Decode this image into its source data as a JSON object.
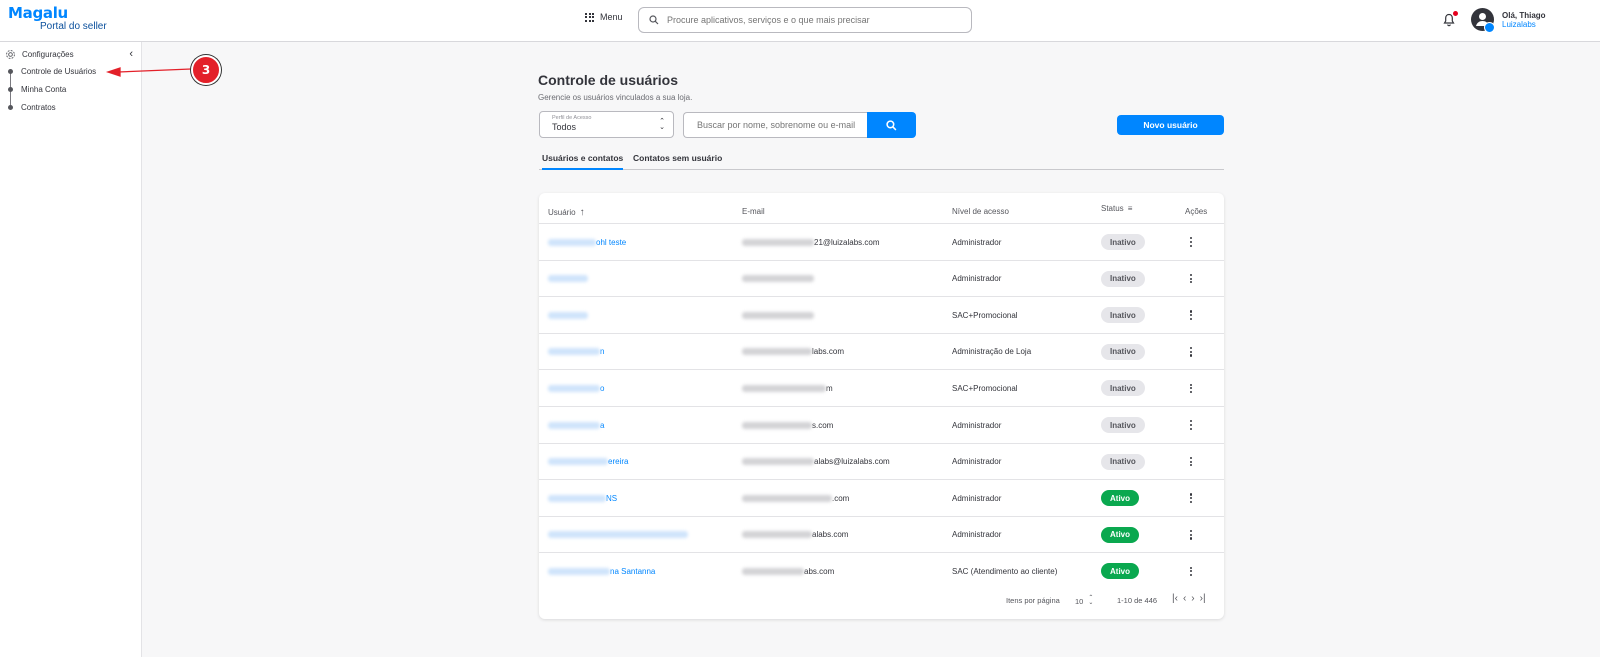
{
  "header": {
    "logo_brand": "Magalu",
    "logo_sub": "Portal do seller",
    "menu_label": "Menu",
    "search_placeholder": "Procure aplicativos, serviços e o que mais precisar",
    "user_greeting": "Olá, Thiago",
    "user_company": "Luizalabs"
  },
  "sidebar": {
    "section_title": "Configurações",
    "items": [
      {
        "label": "Controle de Usuários"
      },
      {
        "label": "Minha Conta"
      },
      {
        "label": "Contratos"
      }
    ]
  },
  "annotation": {
    "step_number": "3"
  },
  "main": {
    "title": "Controle de usuários",
    "subtitle": "Gerencie os usuários vinculados a sua loja.",
    "filter": {
      "label": "Perfil de Acesso",
      "value": "Todos"
    },
    "search_placeholder": "Buscar por nome, sobrenome ou e-mail",
    "new_user_label": "Novo usuário",
    "tabs": [
      {
        "label": "Usuários e contatos",
        "active": true
      },
      {
        "label": "Contatos sem usuário",
        "active": false
      }
    ],
    "table": {
      "columns": [
        "Usuário",
        "E-mail",
        "Nível de acesso",
        "Status",
        "Ações"
      ],
      "rows": [
        {
          "name_suffix": "ohl teste",
          "email_suffix": "21@luizalabs.com",
          "access": "Administrador",
          "status": "Inativo"
        },
        {
          "name_suffix": "",
          "email_suffix": "",
          "access": "Administrador",
          "status": "Inativo"
        },
        {
          "name_suffix": "",
          "email_suffix": "",
          "access": "SAC+Promocional",
          "status": "Inativo"
        },
        {
          "name_suffix": "n",
          "email_suffix": "labs.com",
          "access": "Administração de Loja",
          "status": "Inativo"
        },
        {
          "name_suffix": "o",
          "email_suffix": "m",
          "access": "SAC+Promocional",
          "status": "Inativo"
        },
        {
          "name_suffix": "a",
          "email_suffix": "s.com",
          "access": "Administrador",
          "status": "Inativo"
        },
        {
          "name_suffix": "ereira",
          "email_suffix": "alabs@luizalabs.com",
          "access": "Administrador",
          "status": "Inativo"
        },
        {
          "name_suffix": "NS",
          "email_suffix": ".com",
          "access": "Administrador",
          "status": "Ativo"
        },
        {
          "name_suffix": "",
          "email_suffix": "alabs.com",
          "access": "Administrador",
          "status": "Ativo"
        },
        {
          "name_suffix": "na Santanna",
          "email_suffix": "abs.com",
          "access": "SAC (Atendimento ao cliente)",
          "status": "Ativo"
        }
      ]
    },
    "pagination": {
      "items_per_page_label": "Itens por página",
      "page_size": "10",
      "range": "1-10 de 446"
    }
  },
  "colors": {
    "accent": "#0086ff",
    "active_badge": "#0aa84f",
    "annotation_red": "#e32029"
  }
}
